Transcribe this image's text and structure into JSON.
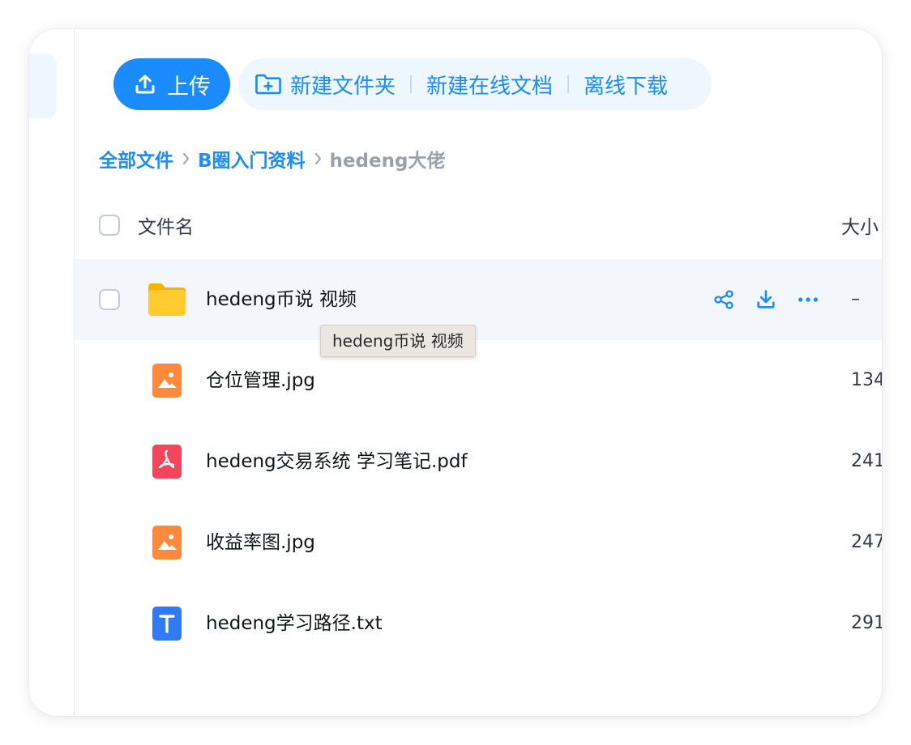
{
  "toolbar": {
    "upload_label": "上传",
    "new_folder_label": "新建文件夹",
    "new_doc_label": "新建在线文档",
    "offline_download_label": "离线下载"
  },
  "breadcrumb": {
    "items": [
      "全部文件",
      "B圈入门资料",
      "hedeng大佬"
    ]
  },
  "table": {
    "col_name": "文件名",
    "col_size": "大小"
  },
  "files": [
    {
      "name": "hedeng币说 视频",
      "size": "–",
      "type": "folder-icon"
    },
    {
      "name": "仓位管理.jpg",
      "size": "134",
      "type": "image-file-icon"
    },
    {
      "name": "hedeng交易系统 学习笔记.pdf",
      "size": "241",
      "type": "pdf-file-icon"
    },
    {
      "name": "收益率图.jpg",
      "size": "247",
      "type": "image-file-icon"
    },
    {
      "name": "hedeng学习路径.txt",
      "size": "291",
      "type": "text-file-icon"
    }
  ],
  "tooltip": {
    "text": "hedeng币说  视频"
  },
  "colors": {
    "accent": "#1a8cff",
    "folder": "#ffc93c",
    "image": "#ff8a3d",
    "pdf": "#f5455c",
    "text_doc": "#2f7bf5"
  }
}
